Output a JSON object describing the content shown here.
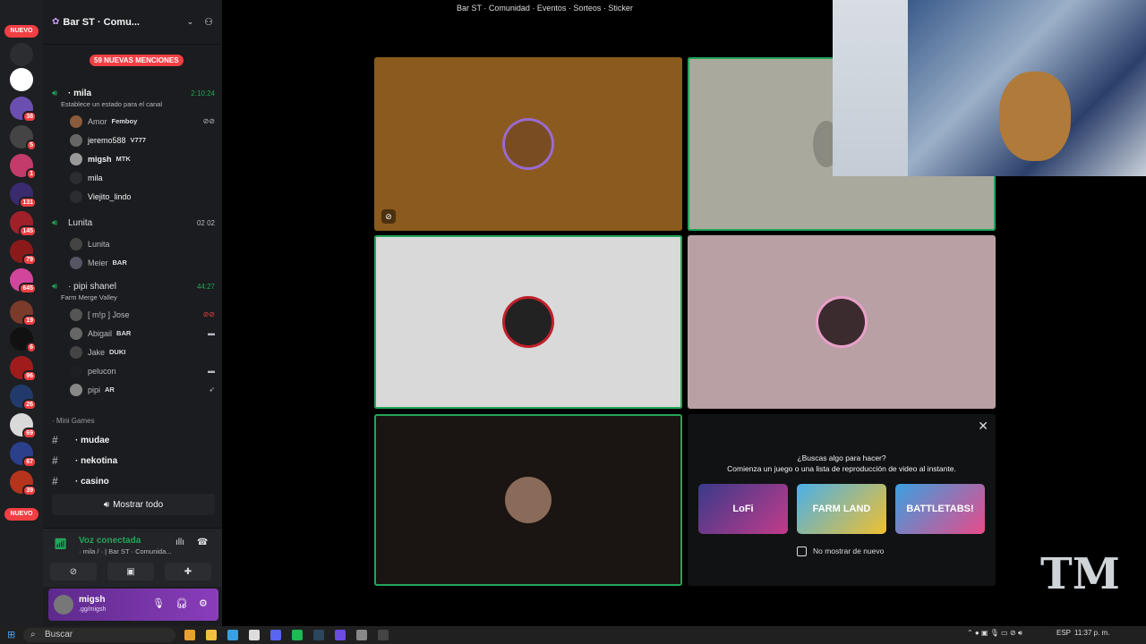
{
  "window_title": "Bar ST · Comunidad · Eventos · Sorteos · Sticker",
  "rail": {
    "new_top": "NUEVO",
    "new_bottom": "NUEVO",
    "badges": [
      "38",
      "5",
      "1",
      "131",
      "145",
      "79",
      "645",
      "19",
      "6",
      "96",
      "26",
      "69",
      "67",
      "39"
    ]
  },
  "server": {
    "title": "Bar ST · Comu...",
    "mentions": "59 NUEVAS MENCIONES"
  },
  "voice_channels": [
    {
      "name": "· mila",
      "timer": "2:10:24",
      "status": "Establece un estado para el canal",
      "members": [
        {
          "name": "Amor",
          "tag": "Femboy"
        },
        {
          "name": "jeremo588",
          "tag": "V777"
        },
        {
          "name": "migsh",
          "tag": "MTK"
        },
        {
          "name": "mila",
          "tag": ""
        },
        {
          "name": "Viejito_lindo",
          "tag": ""
        }
      ]
    },
    {
      "name": "Lunita",
      "timer": "02  02",
      "status": "",
      "members": [
        {
          "name": "Lunita",
          "tag": ""
        },
        {
          "name": "Meier",
          "tag": "BAR"
        }
      ]
    },
    {
      "name": "· pipi shanel",
      "timer": "44:27",
      "status": "Farm Merge Valley",
      "members": [
        {
          "name": "[ m!p ] Jose",
          "tag": ""
        },
        {
          "name": "Abigail",
          "tag": "BAR"
        },
        {
          "name": "Jake",
          "tag": "DUKI"
        },
        {
          "name": "pelucon",
          "tag": ""
        },
        {
          "name": "pipi",
          "tag": "AR"
        }
      ]
    }
  ],
  "category": "· Mini Games",
  "text_channels": [
    "· mudae",
    "· nekotina",
    "· casino"
  ],
  "show_all": "Mostrar todo",
  "voice_panel": {
    "title": "Voz conectada",
    "sub": "· mila / · | Bar ST · Comunida..."
  },
  "user": {
    "name": "migsh",
    "sub": ".gg/migsh"
  },
  "activity": {
    "question": "¿Buscas algo para hacer?",
    "subtitle": "Comienza un juego o una lista de reproducción de video al instante.",
    "cards": [
      "LoFi",
      "FARM LAND",
      "BATTLETABS!"
    ],
    "checkbox_label": "No mostrar de nuevo"
  },
  "taskbar": {
    "search": "Buscar",
    "lang": "ESP",
    "time": "11:37 p. m."
  },
  "colors": {
    "speaking": "#23a559",
    "mention": "#f23f43",
    "tile_brown": "#8b5a1e",
    "tile_gray": "#a9a99e",
    "tile_light": "#d9d9d9",
    "tile_pink": "#b9a0a4",
    "tile_dark": "#1a1412"
  }
}
